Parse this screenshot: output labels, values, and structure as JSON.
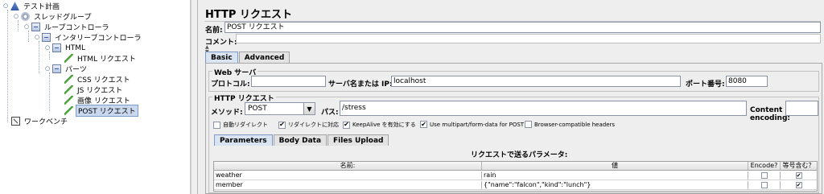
{
  "tree": {
    "nodes": [
      {
        "label": "テスト計画",
        "icon": "test-plan-icon"
      },
      {
        "label": "スレッドグループ",
        "icon": "thread-group-icon"
      },
      {
        "label": "ループコントローラ",
        "icon": "loop-controller-icon"
      },
      {
        "label": "インタリーブコントローラ",
        "icon": "interleave-controller-icon"
      },
      {
        "label": "HTML",
        "icon": "controller-icon"
      },
      {
        "label": "HTML リクエスト",
        "icon": "sampler-icon"
      },
      {
        "label": "パーツ",
        "icon": "controller-icon"
      },
      {
        "label": "CSS リクエスト",
        "icon": "sampler-icon"
      },
      {
        "label": "JS リクエスト",
        "icon": "sampler-icon"
      },
      {
        "label": "画像 リクエスト",
        "icon": "sampler-icon"
      },
      {
        "label": "POST リクエスト",
        "icon": "sampler-icon",
        "selected": true
      },
      {
        "label": "ワークベンチ",
        "icon": "workbench-icon"
      }
    ]
  },
  "panel": {
    "title": "HTTP リクエスト",
    "name_label": "名前:",
    "name_value": "POST リクエスト",
    "comment_label": "コメント:",
    "comment_value": "",
    "tabs": [
      "Basic",
      "Advanced"
    ],
    "web_server": {
      "title": "Web サーバ",
      "protocol_label": "プロトコル:",
      "protocol_value": "",
      "server_label": "サーバ名または IP:",
      "server_value": "localhost",
      "port_label": "ポート番号:",
      "port_value": "8080"
    },
    "http_request": {
      "title": "HTTP リクエスト",
      "method_label": "メソッド:",
      "method_value": "POST",
      "path_label": "パス:",
      "path_value": "/stress",
      "encoding_label": "Content encoding:",
      "encoding_value": "",
      "checkboxes": [
        {
          "label": "自動リダイレクト",
          "checked": false
        },
        {
          "label": "リダイレクトに対応",
          "checked": true
        },
        {
          "label": "KeepAlive を有効にする",
          "checked": true
        },
        {
          "label": "Use multipart/form-data for POST",
          "checked": true
        },
        {
          "label": "Browser-compatible headers",
          "checked": false
        }
      ]
    },
    "sub_tabs": [
      "Parameters",
      "Body Data",
      "Files Upload"
    ],
    "params": {
      "caption": "リクエストで送るパラメータ:",
      "columns": [
        "名前:",
        "値",
        "Encode?",
        "等号含む？"
      ],
      "rows": [
        {
          "name": "weather",
          "value": "rain",
          "encode": false,
          "include_equals": true
        },
        {
          "name": "member",
          "value": "{\"name\":\"falcon\",\"kind\":\"lunch\"}",
          "encode": false,
          "include_equals": true
        }
      ]
    }
  }
}
